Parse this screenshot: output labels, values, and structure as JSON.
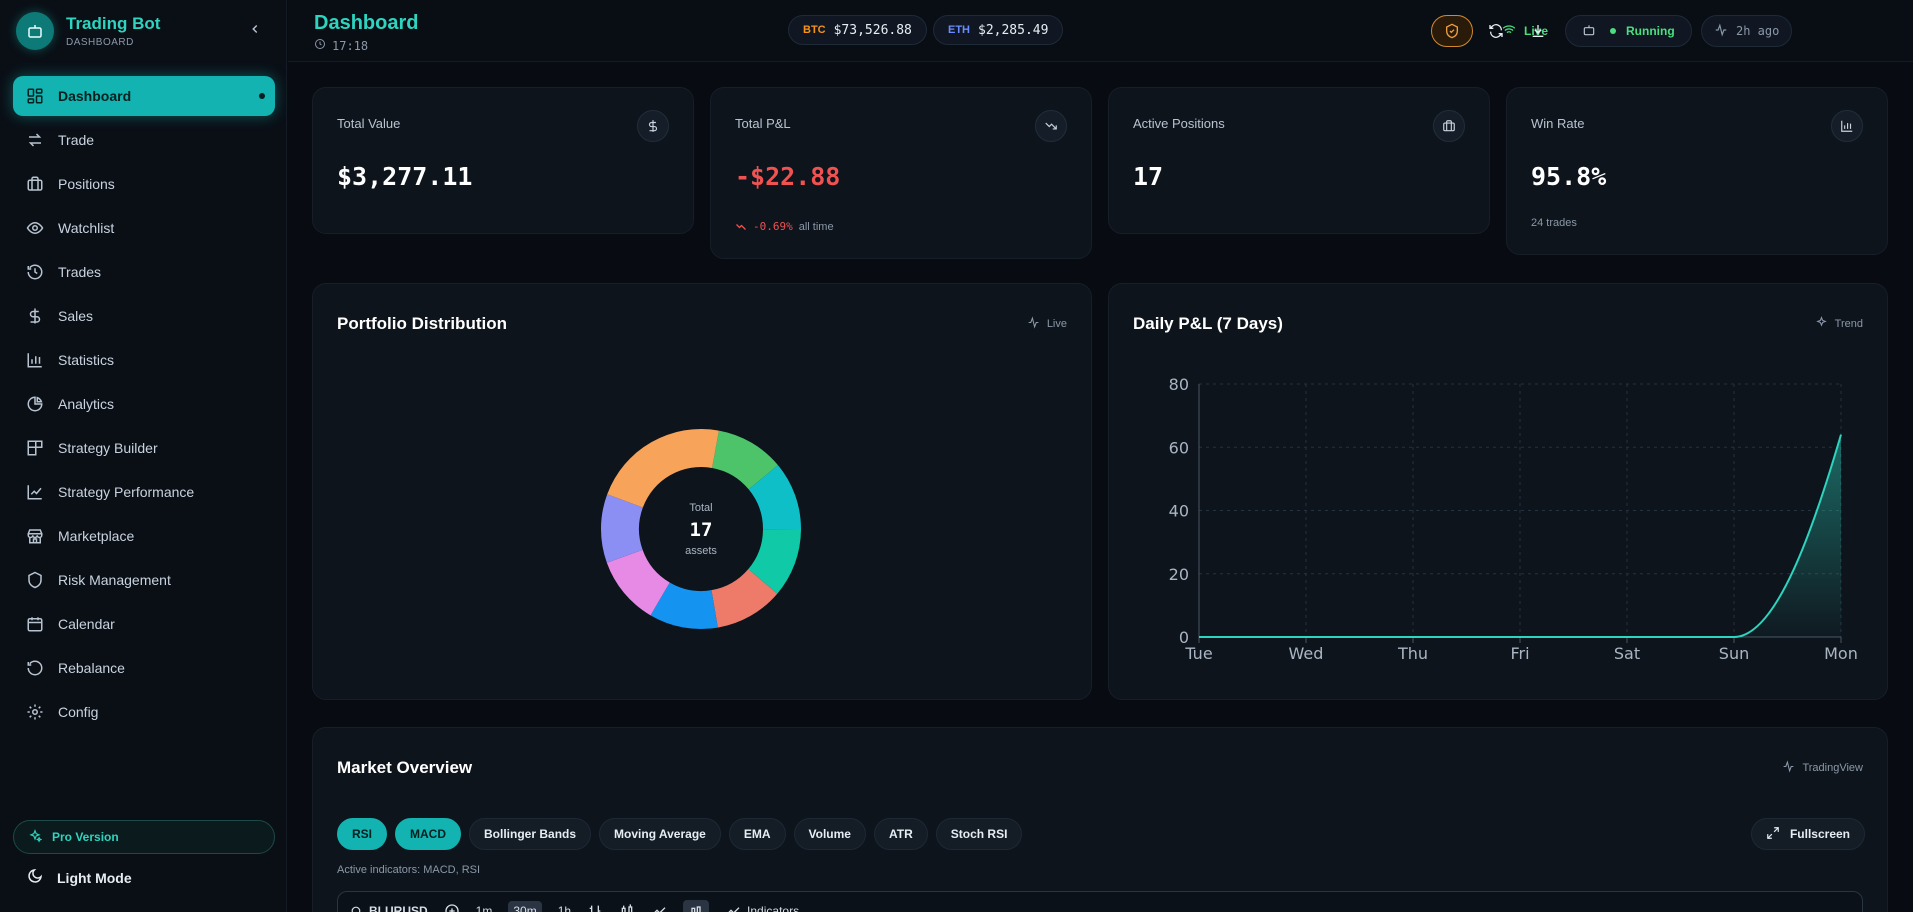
{
  "brand": {
    "title": "Trading Bot",
    "subtitle": "DASHBOARD"
  },
  "header": {
    "title": "Dashboard",
    "time": "17:18",
    "btc": {
      "symbol": "BTC",
      "price": "$73,526.88",
      "color": "#f7931a"
    },
    "eth": {
      "symbol": "ETH",
      "price": "$2,285.49",
      "color": "#6b8cff"
    },
    "live_label": "Live",
    "running_label": "Running",
    "ago_label": "2h ago"
  },
  "sidebar": {
    "items": [
      {
        "label": "Dashboard",
        "icon": "dashboard-grid-icon"
      },
      {
        "label": "Trade",
        "icon": "swap-arrows-icon"
      },
      {
        "label": "Positions",
        "icon": "briefcase-icon"
      },
      {
        "label": "Watchlist",
        "icon": "eye-icon"
      },
      {
        "label": "Trades",
        "icon": "history-icon"
      },
      {
        "label": "Sales",
        "icon": "dollar-icon"
      },
      {
        "label": "Statistics",
        "icon": "bar-chart-icon"
      },
      {
        "label": "Analytics",
        "icon": "pie-chart-icon"
      },
      {
        "label": "Strategy Builder",
        "icon": "blocks-icon"
      },
      {
        "label": "Strategy Performance",
        "icon": "line-chart-icon"
      },
      {
        "label": "Marketplace",
        "icon": "store-icon"
      },
      {
        "label": "Risk Management",
        "icon": "shield-icon"
      },
      {
        "label": "Calendar",
        "icon": "calendar-icon"
      },
      {
        "label": "Rebalance",
        "icon": "rotate-icon"
      },
      {
        "label": "Config",
        "icon": "gear-icon"
      }
    ],
    "pro_label": "Pro Version",
    "theme_label": "Light Mode"
  },
  "stats": {
    "total_value": {
      "label": "Total Value",
      "value": "$3,277.11"
    },
    "total_pnl": {
      "label": "Total P&L",
      "value": "-$22.88",
      "change": "-0.69%",
      "change_suffix": "all time"
    },
    "active_positions": {
      "label": "Active Positions",
      "value": "17"
    },
    "win_rate": {
      "label": "Win Rate",
      "value": "95.8%",
      "sub": "24 trades"
    }
  },
  "portfolio": {
    "title": "Portfolio Distribution",
    "tag": "Live",
    "center_label": "Total",
    "center_value": "17",
    "center_sub": "assets",
    "slices": [
      {
        "value": 1,
        "color": "#4ec46a"
      },
      {
        "value": 1,
        "color": "#0fbfc8"
      },
      {
        "value": 1,
        "color": "#10c9a6"
      },
      {
        "value": 1,
        "color": "#ee7a6a"
      },
      {
        "value": 1,
        "color": "#1493f0"
      },
      {
        "value": 1,
        "color": "#e68ae6"
      },
      {
        "value": 1,
        "color": "#8b8ff4"
      },
      {
        "value": 2,
        "color": "#f7a35a"
      }
    ]
  },
  "daily_pnl": {
    "title": "Daily P&L (7 Days)",
    "tag": "Trend"
  },
  "chart_data": {
    "type": "area",
    "categories": [
      "Tue",
      "Wed",
      "Thu",
      "Fri",
      "Sat",
      "Sun",
      "Mon"
    ],
    "series": [
      {
        "values": [
          0,
          0,
          0,
          0,
          0,
          0,
          64
        ]
      }
    ],
    "ylim": [
      0,
      80
    ],
    "yticks": [
      0,
      20,
      40,
      60,
      80
    ],
    "grid": true,
    "color": "#2dd4bf"
  },
  "market": {
    "title": "Market Overview",
    "tag": "TradingView",
    "indicators": [
      {
        "label": "RSI",
        "on": true
      },
      {
        "label": "MACD",
        "on": true
      },
      {
        "label": "Bollinger Bands",
        "on": false
      },
      {
        "label": "Moving Average",
        "on": false
      },
      {
        "label": "EMA",
        "on": false
      },
      {
        "label": "Volume",
        "on": false
      },
      {
        "label": "ATR",
        "on": false
      },
      {
        "label": "Stoch RSI",
        "on": false
      }
    ],
    "fullscreen_label": "Fullscreen",
    "active_text": "Active indicators: MACD, RSI",
    "toolbar": {
      "symbol": "BLURUSD",
      "intervals": [
        "1m",
        "30m",
        "1h"
      ],
      "indicators_label": "Indicators"
    }
  },
  "colors": {
    "accent": "#12b3b0",
    "negative": "#f05252",
    "positive": "#4ade80"
  }
}
